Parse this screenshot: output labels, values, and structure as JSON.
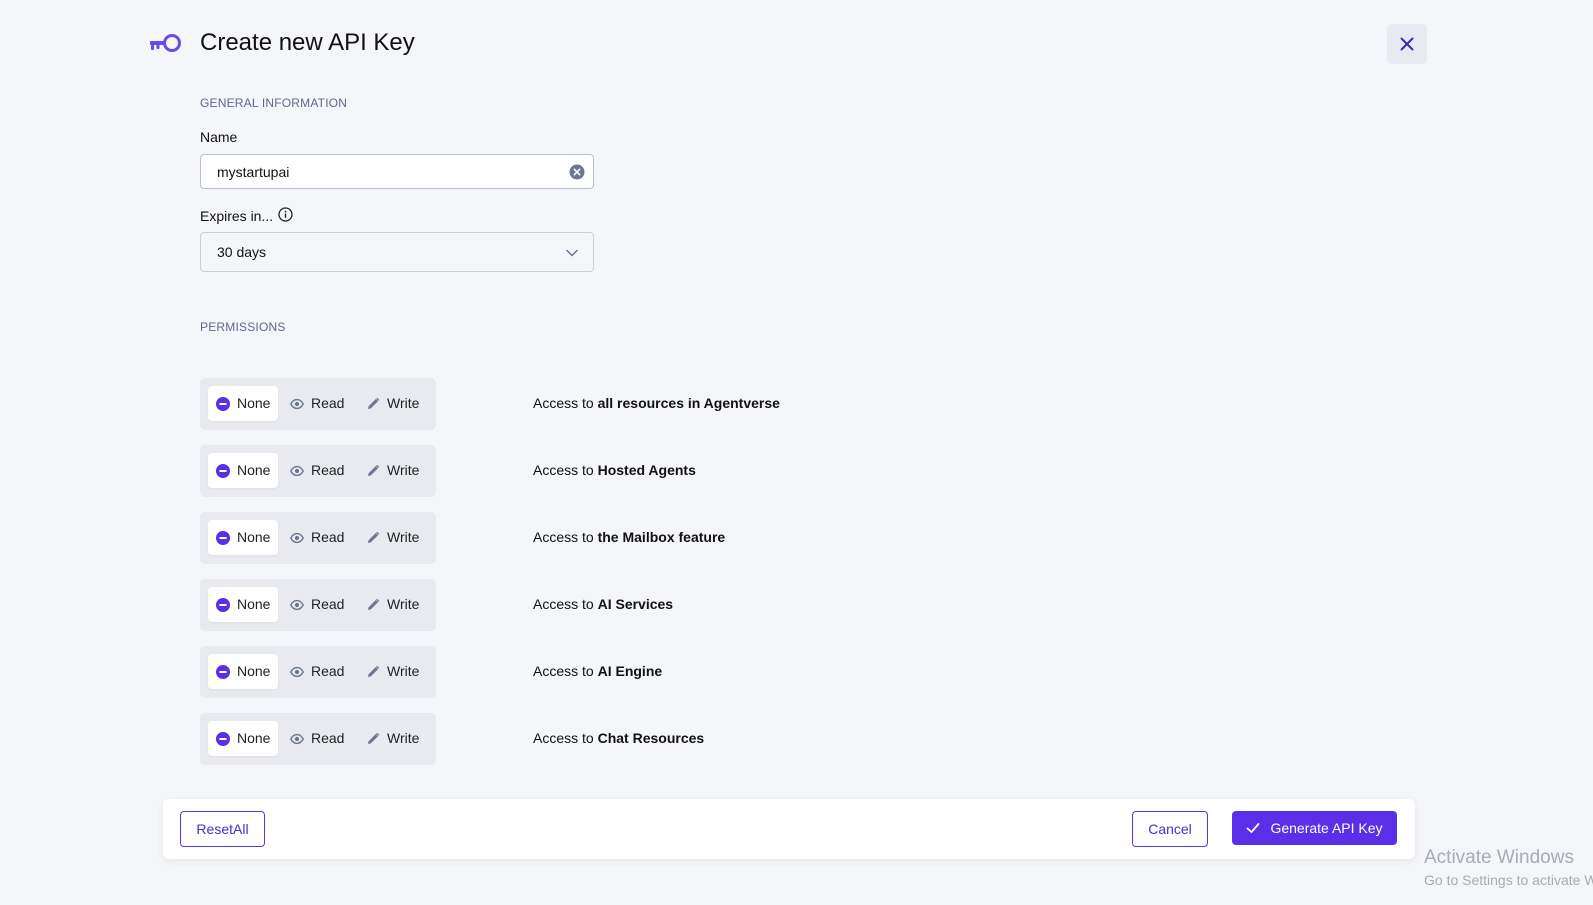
{
  "header": {
    "title": "Create new API Key",
    "icon": "key-icon",
    "close_icon": "close-icon"
  },
  "general": {
    "heading": "GENERAL INFORMATION",
    "name_label": "Name",
    "name_value": "mystartupai",
    "expires_label": "Expires in...",
    "expires_value": "30 days"
  },
  "permissions": {
    "heading": "PERMISSIONS",
    "options": {
      "none": "None",
      "read": "Read",
      "write": "Write"
    },
    "prefix": "Access to ",
    "rows": [
      {
        "resource": "all resources in Agentverse",
        "selected": "None"
      },
      {
        "resource": "Hosted Agents",
        "selected": "None"
      },
      {
        "resource": "the Mailbox feature",
        "selected": "None"
      },
      {
        "resource": "AI Services",
        "selected": "None"
      },
      {
        "resource": "AI Engine",
        "selected": "None"
      },
      {
        "resource": "Chat Resources",
        "selected": "None"
      }
    ]
  },
  "footer": {
    "reset_label": "ResetAll",
    "cancel_label": "Cancel",
    "generate_label": "Generate API Key"
  },
  "watermark": {
    "title": "Activate Windows",
    "subtitle": "Go to Settings to activate Windows."
  },
  "colors": {
    "accent": "#5b2ee8",
    "background": "#f5f6f9",
    "icon_muted": "#6b7791"
  }
}
